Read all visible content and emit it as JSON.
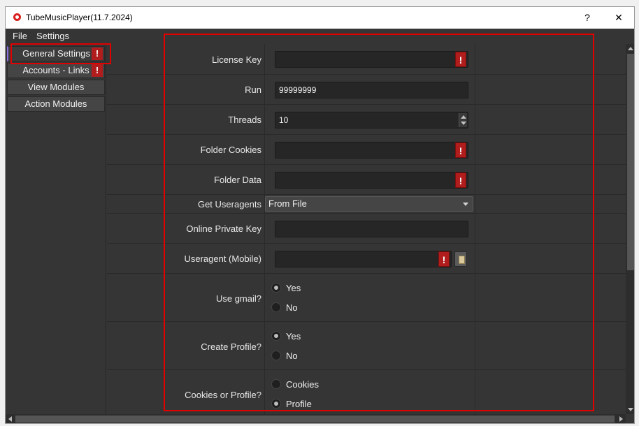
{
  "window": {
    "title": "TubeMusicPlayer(11.7.2024)",
    "help_label": "?",
    "close_label": "✕"
  },
  "menu": {
    "file": "File",
    "settings": "Settings"
  },
  "sidebar": {
    "items": [
      {
        "label": "General Settings",
        "warning": "!",
        "active": true
      },
      {
        "label": "Accounts - Links",
        "warning": "!"
      },
      {
        "label": "View Modules"
      },
      {
        "label": "Action Modules"
      }
    ]
  },
  "form": {
    "license_key": {
      "label": "License Key",
      "value": "",
      "warning": "!"
    },
    "run": {
      "label": "Run",
      "value": "99999999"
    },
    "threads": {
      "label": "Threads",
      "value": "10"
    },
    "folder_cookies": {
      "label": "Folder Cookies",
      "value": "",
      "warning": "!"
    },
    "folder_data": {
      "label": "Folder Data",
      "value": "",
      "warning": "!"
    },
    "get_useragents": {
      "label": "Get Useragents",
      "selected": "From File"
    },
    "online_private_key": {
      "label": "Online Private Key",
      "value": ""
    },
    "useragent_mobile": {
      "label": "Useragent  (Mobile)",
      "value": "",
      "warning": "!"
    },
    "use_gmail": {
      "label": "Use gmail?",
      "options": [
        "Yes",
        "No"
      ],
      "selected": "Yes"
    },
    "create_profile": {
      "label": "Create Profile?",
      "options": [
        "Yes",
        "No"
      ],
      "selected": "Yes"
    },
    "cookies_or_profile": {
      "label": "Cookies or Profile?",
      "options": [
        "Cookies",
        "Profile"
      ],
      "selected": "Profile"
    }
  },
  "colors": {
    "background": "#353535",
    "field": "#262626",
    "warning": "#b11d1d",
    "highlight": "#e00000"
  }
}
